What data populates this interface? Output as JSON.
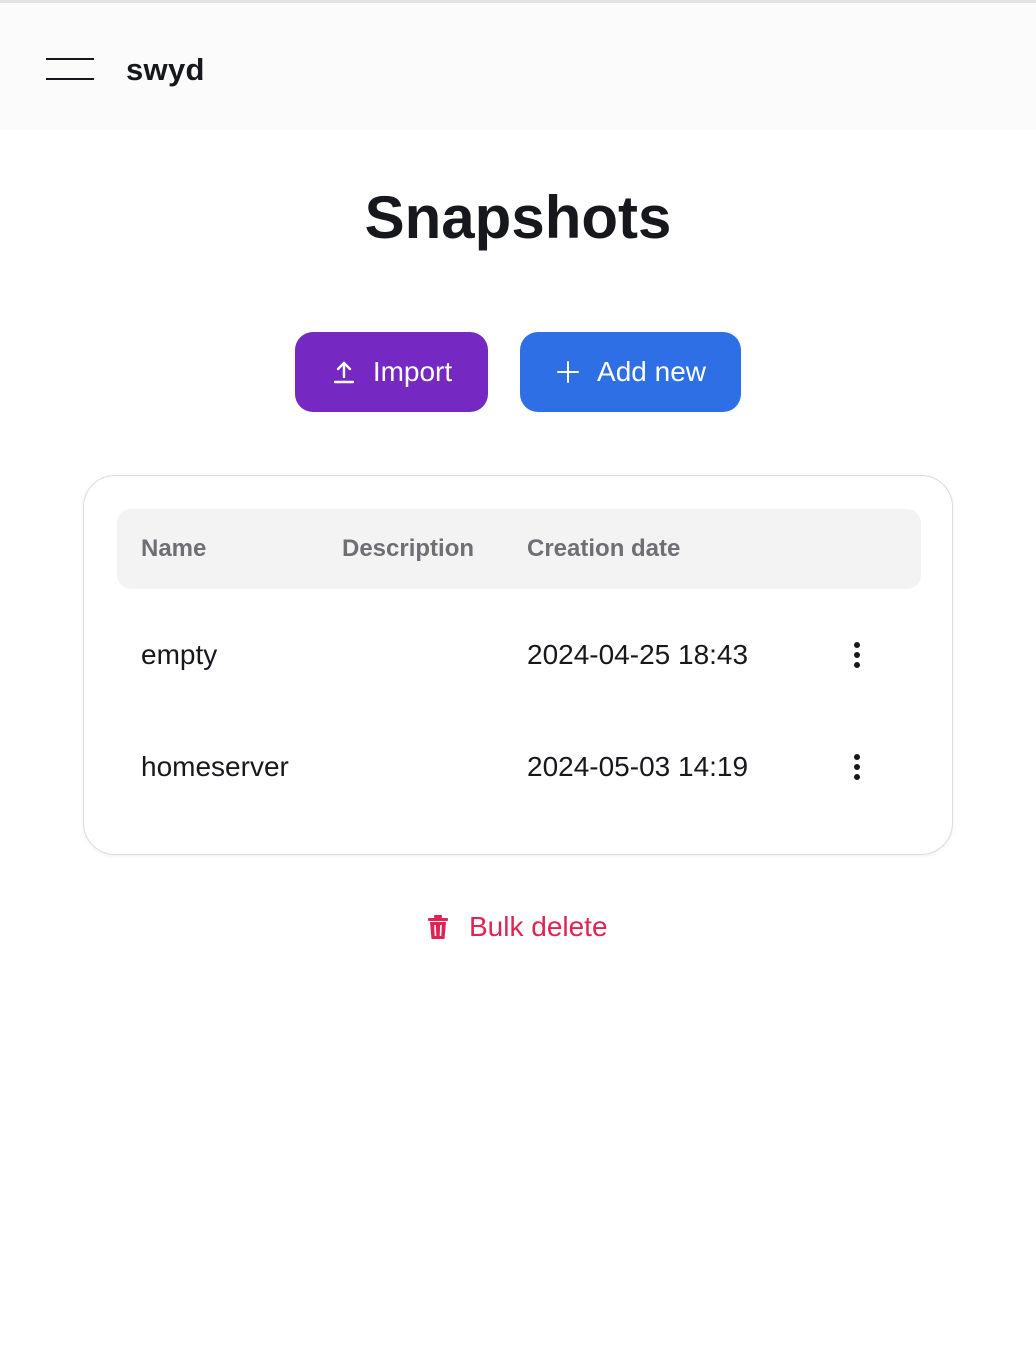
{
  "header": {
    "app_title": "swyd",
    "menu_icon": "hamburger-menu-icon"
  },
  "page": {
    "title": "Snapshots"
  },
  "actions": {
    "import_label": "Import",
    "import_icon": "upload-icon",
    "import_color": "#7529c2",
    "add_label": "Add new",
    "add_icon": "plus-icon",
    "add_color": "#2e6fe5"
  },
  "table": {
    "columns": [
      "Name",
      "Description",
      "Creation date"
    ],
    "rows": [
      {
        "name": "empty",
        "description": "",
        "created": "2024-04-25 18:43"
      },
      {
        "name": "homeserver",
        "description": "",
        "created": "2024-05-03 14:19"
      }
    ],
    "row_menu_icon": "kebab-menu-icon"
  },
  "footer": {
    "bulk_delete_label": "Bulk delete",
    "bulk_delete_icon": "trash-icon",
    "danger_color": "#df2355"
  }
}
